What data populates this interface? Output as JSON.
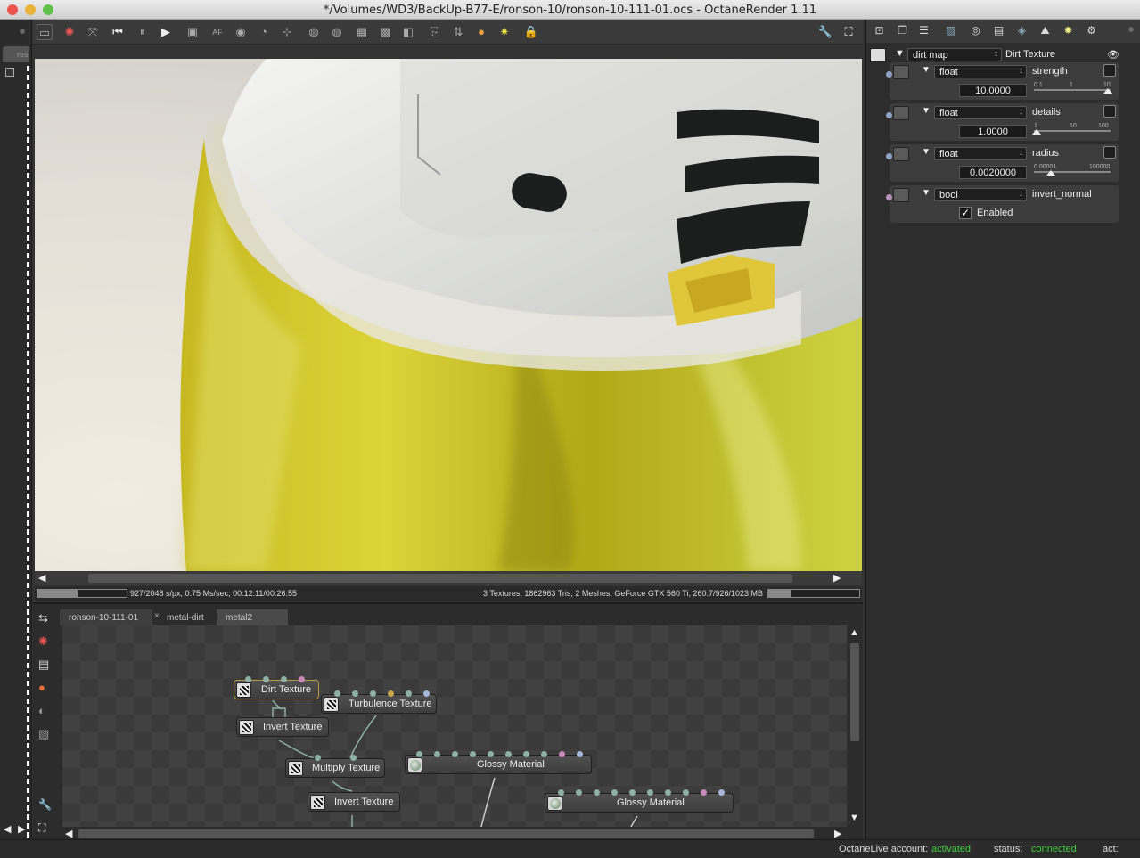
{
  "window": {
    "title": "*/Volumes/WD3/BackUp-B77-E/ronson-10/ronson-10-111-01.ocs - OctaneRender 1.11",
    "traffic_lights": [
      "#e9544c",
      "#e9b33a",
      "#60c04a"
    ]
  },
  "left_strip": {
    "tab_label": "res"
  },
  "toolbar": {
    "icons": [
      "monitor-icon",
      "reset-icon",
      "fit-icon",
      "rewind-icon",
      "pause-icon",
      "play-icon",
      "screen-icon",
      "focus-icon",
      "color-icon",
      "rotate-icon",
      "pick-icon",
      "region-icon",
      "region2-icon",
      "grid-icon",
      "checker-icon",
      "split-icon",
      "copy-icon",
      "export-icon",
      "sphere-icon",
      "light-icon",
      "lock-icon"
    ],
    "right_icons": [
      "wrench-icon",
      "fullscreen-icon"
    ]
  },
  "render_status": {
    "progress_fraction": 0.45,
    "stats_left": "927/2048 s/px, 0.75 Ms/sec, 00:12:11/00:26:55",
    "stats_right": "3 Textures, 1862963 Tris, 2 Meshes, GeForce GTX 560 Ti, 260.7/926/1023 MB",
    "memory_fraction": 0.25
  },
  "node_editor": {
    "tabs": [
      {
        "label": "ronson-10-111-01",
        "active": false
      },
      {
        "label": "metal-dirt",
        "active": true
      },
      {
        "label": "metal2",
        "active": false
      }
    ],
    "nodes": {
      "dirt_texture": "Dirt Texture",
      "turbulence_texture": "Turbulence Texture",
      "invert_texture_1": "Invert Texture",
      "multiply_texture": "Multiply Texture",
      "glossy_material_1": "Glossy Material",
      "invert_texture_2": "Invert Texture",
      "glossy_material_2": "Glossy Material"
    },
    "pin_colors": {
      "float": "#8fb0a4",
      "rgb": "#b89ed0",
      "bool": "#c8a84a",
      "tex": "#a8b8d8"
    }
  },
  "inspector": {
    "header_select": "dirt map",
    "header_type": "Dirt Texture",
    "params": [
      {
        "type": "float",
        "name": "strength",
        "value": "10.0000",
        "ticks": [
          "0.1",
          "1",
          "10"
        ],
        "pin_color": "#8fa3c7"
      },
      {
        "type": "float",
        "name": "details",
        "value": "1.0000",
        "ticks": [
          "1",
          "10",
          "100"
        ],
        "pin_color": "#8fa3c7"
      },
      {
        "type": "float",
        "name": "radius",
        "value": "0.0020000",
        "ticks": [
          "0.00001",
          "100000"
        ],
        "pin_color": "#8fa3c7"
      }
    ],
    "bool_param": {
      "type": "bool",
      "name": "invert_normal",
      "checkbox_label": "Enabled",
      "checked": true,
      "pin_color": "#b994b9"
    }
  },
  "bottom_bar": {
    "account_label": "OctaneLive account:",
    "account_status": "activated",
    "status_label": "status:",
    "status_value": "connected",
    "act_label": "act:",
    "status_color": "#3fcf3f"
  }
}
